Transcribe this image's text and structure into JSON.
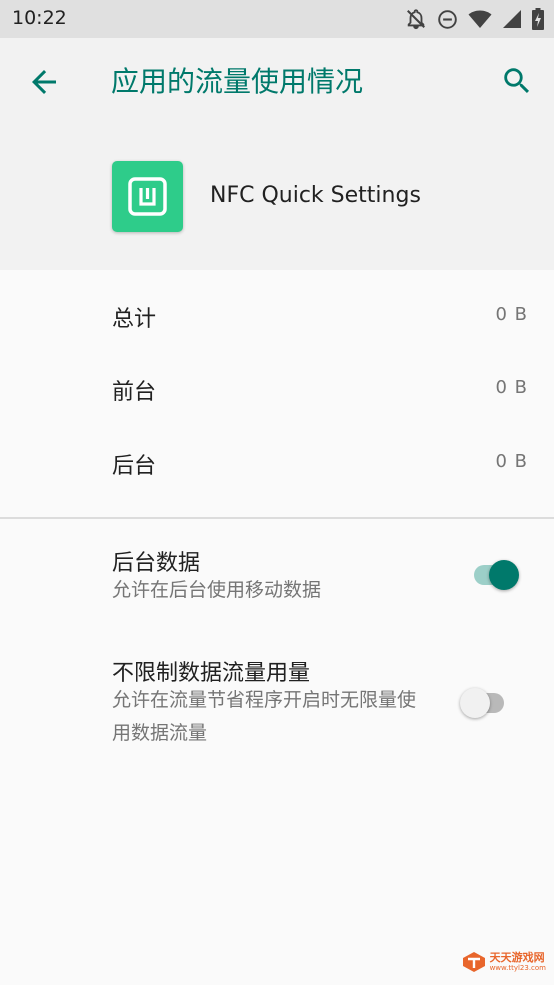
{
  "status_bar": {
    "time": "10:22",
    "icons": [
      "notifications-off-icon",
      "do-not-disturb-icon",
      "wifi-icon",
      "signal-icon",
      "battery-charging-icon"
    ]
  },
  "header": {
    "title": "应用的流量使用情况",
    "back_icon": "arrow-back-icon",
    "search_icon": "search-icon"
  },
  "app": {
    "name": "NFC Quick Settings",
    "icon": "nfc-app-icon",
    "icon_color": "#2ecc8a"
  },
  "usage": [
    {
      "label": "总计",
      "value": "0 B"
    },
    {
      "label": "前台",
      "value": "0 B"
    },
    {
      "label": "后台",
      "value": "0 B"
    }
  ],
  "preferences": {
    "background_data": {
      "title": "后台数据",
      "summary": "允许在后台使用移动数据",
      "enabled": true
    },
    "unrestricted_data": {
      "title": "不限制数据流量用量",
      "summary": "允许在流量节省程序开启时无限量使用数据流量",
      "enabled": false
    }
  },
  "colors": {
    "accent": "#00796b",
    "switch_track_on": "#9ccfc8",
    "header_background": "#f2f2f2",
    "status_bar_background": "#e0e0e0"
  },
  "watermark": {
    "title": "天天游戏网",
    "url": "www.ttyl23.com"
  }
}
